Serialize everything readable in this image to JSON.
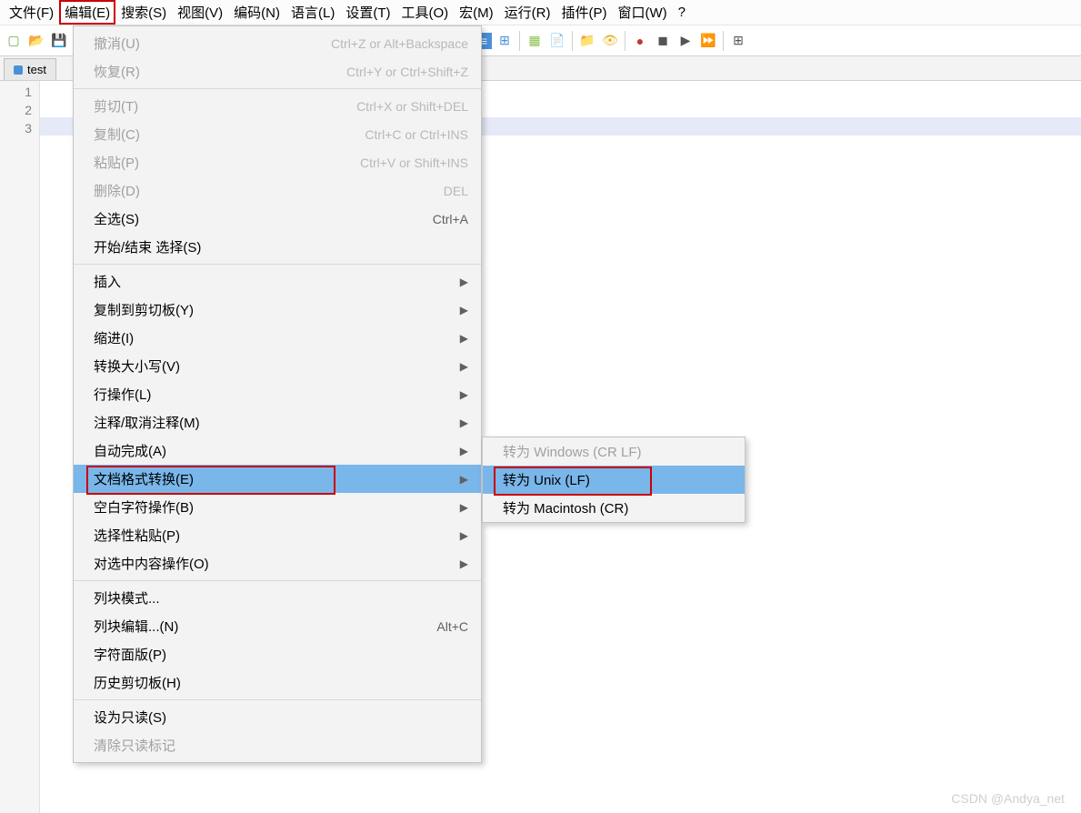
{
  "menubar": {
    "items": [
      "文件(F)",
      "编辑(E)",
      "搜索(S)",
      "视图(V)",
      "编码(N)",
      "语言(L)",
      "设置(T)",
      "工具(O)",
      "宏(M)",
      "运行(R)",
      "插件(P)",
      "窗口(W)",
      "?"
    ]
  },
  "tab": {
    "label": "test"
  },
  "gutter": {
    "lines": [
      "1",
      "2",
      "3"
    ]
  },
  "edit_menu": {
    "groups": [
      [
        {
          "label": "撤消(U)",
          "accel": "Ctrl+Z or Alt+Backspace",
          "disabled": true
        },
        {
          "label": "恢复(R)",
          "accel": "Ctrl+Y or Ctrl+Shift+Z",
          "disabled": true
        }
      ],
      [
        {
          "label": "剪切(T)",
          "accel": "Ctrl+X or Shift+DEL",
          "disabled": true
        },
        {
          "label": "复制(C)",
          "accel": "Ctrl+C or Ctrl+INS",
          "disabled": true
        },
        {
          "label": "粘贴(P)",
          "accel": "Ctrl+V or Shift+INS",
          "disabled": true
        },
        {
          "label": "删除(D)",
          "accel": "DEL",
          "disabled": true
        },
        {
          "label": "全选(S)",
          "accel": "Ctrl+A"
        },
        {
          "label": "开始/结束 选择(S)"
        }
      ],
      [
        {
          "label": "插入",
          "sub": true
        },
        {
          "label": "复制到剪切板(Y)",
          "sub": true
        },
        {
          "label": "缩进(I)",
          "sub": true
        },
        {
          "label": "转换大小写(V)",
          "sub": true
        },
        {
          "label": "行操作(L)",
          "sub": true
        },
        {
          "label": "注释/取消注释(M)",
          "sub": true
        },
        {
          "label": "自动完成(A)",
          "sub": true
        },
        {
          "label": "文档格式转换(E)",
          "sub": true,
          "hl": true,
          "boxed": true
        },
        {
          "label": "空白字符操作(B)",
          "sub": true
        },
        {
          "label": "选择性粘贴(P)",
          "sub": true
        },
        {
          "label": "对选中内容操作(O)",
          "sub": true
        }
      ],
      [
        {
          "label": "列块模式..."
        },
        {
          "label": "列块编辑...(N)",
          "accel": "Alt+C"
        },
        {
          "label": "字符面版(P)"
        },
        {
          "label": "历史剪切板(H)"
        }
      ],
      [
        {
          "label": "设为只读(S)"
        },
        {
          "label": "清除只读标记",
          "disabled": true
        }
      ]
    ]
  },
  "eol_submenu": {
    "items": [
      {
        "label": "转为 Windows (CR LF)",
        "disabled": true
      },
      {
        "label": "转为 Unix (LF)",
        "hl": true,
        "boxed": true
      },
      {
        "label": "转为 Macintosh (CR)"
      }
    ]
  },
  "watermark": "CSDN @Andya_net",
  "toolbar_icons": [
    "new",
    "open",
    "save",
    "save-all",
    "close",
    "close-all",
    "print",
    "sep",
    "cut",
    "copy",
    "paste",
    "sep",
    "undo",
    "redo",
    "sep",
    "find",
    "replace",
    "sep",
    "zoom-in",
    "zoom-out",
    "sep",
    "sync",
    "sep",
    "wrap",
    "sep",
    "show-ws",
    "indent-guide",
    "sep",
    "folder",
    "lang",
    "sep",
    "doc-map",
    "func-list",
    "sep",
    "folder2",
    "eye",
    "sep",
    "record",
    "stop",
    "play",
    "play-multi",
    "sep",
    "macro-list"
  ]
}
